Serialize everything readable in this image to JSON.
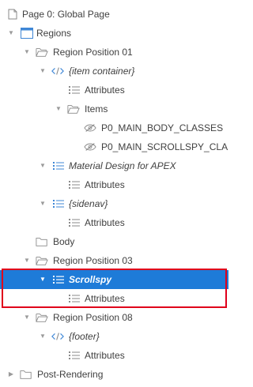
{
  "tree": {
    "page": "Page 0: Global Page",
    "regions": "Regions",
    "region_pos_01": "Region Position 01",
    "item_container": "{item container}",
    "attributes": "Attributes",
    "items": "Items",
    "item_1": "P0_MAIN_BODY_CLASSES",
    "item_2": "P0_MAIN_SCROLLSPY_CLA",
    "material_design": "Material Design for APEX",
    "sidenav": "{sidenav}",
    "body": "Body",
    "region_pos_03": "Region Position 03",
    "scrollspy": "Scrollspy",
    "region_pos_08": "Region Position 08",
    "footer": "{footer}",
    "post_rendering": "Post-Rendering"
  },
  "colors": {
    "selection": "#1e7bd8",
    "highlight_border": "#e0001b",
    "list_icon": "#3f87d6",
    "code_icon": "#3f87d6",
    "folder_icon": "#8a8a8a"
  },
  "icons": {
    "page": "page-icon",
    "regions": "region-layout-icon",
    "folder": "folder-icon",
    "code": "code-icon",
    "list": "list-icon",
    "hidden": "eye-slash-icon"
  }
}
